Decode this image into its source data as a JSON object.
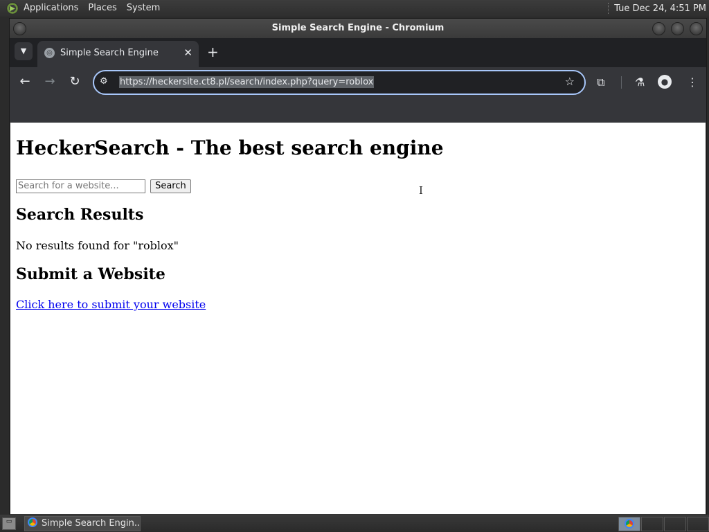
{
  "desktop": {
    "menus": [
      "Applications",
      "Places",
      "System"
    ],
    "clock": "Tue Dec 24,  4:51 PM"
  },
  "window": {
    "title": "Simple Search Engine - Chromium"
  },
  "browser": {
    "tab_title": "Simple Search Engine",
    "url": "https://heckersite.ct8.pl/search/index.php?query=roblox"
  },
  "page": {
    "heading": "HeckerSearch - The best search engine",
    "search_placeholder": "Search for a website...",
    "search_button": "Search",
    "results_heading": "Search Results",
    "no_results": "No results found for \"roblox\"",
    "submit_heading": "Submit a Website",
    "submit_link": "Click here to submit your website"
  },
  "taskbar": {
    "task_label": "Simple Search Engin..."
  },
  "colors": {
    "link": "#0000ee",
    "omnibox_focus": "#a8c7fa"
  }
}
